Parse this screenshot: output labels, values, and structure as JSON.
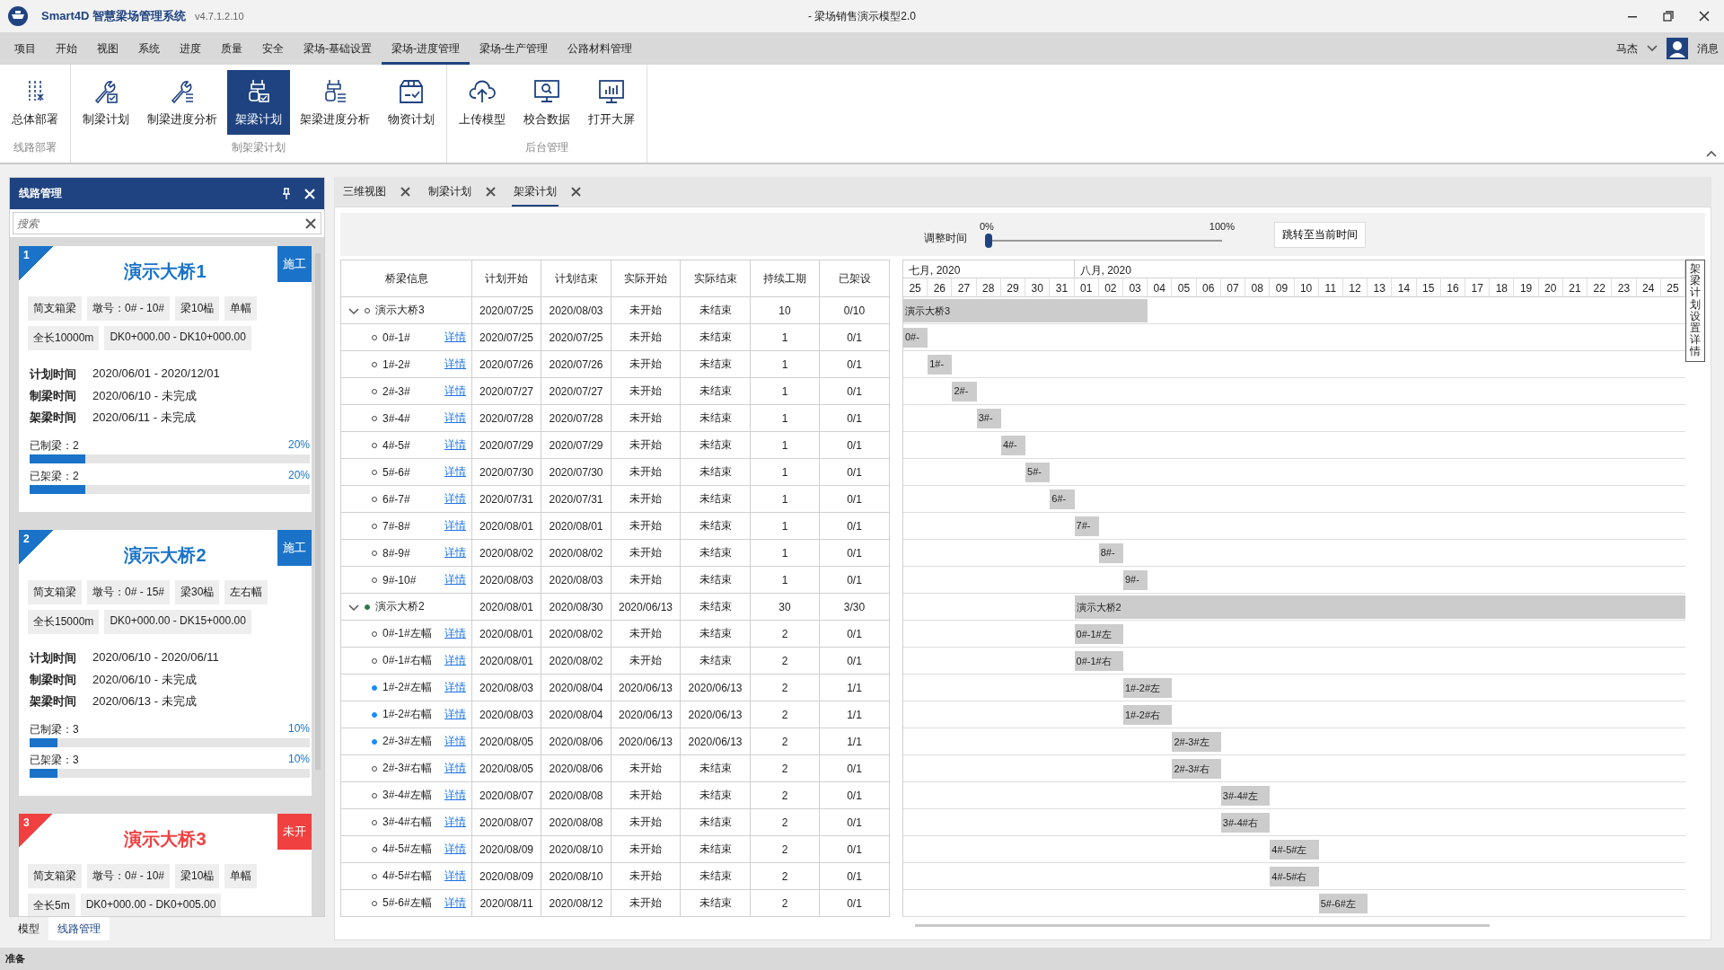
{
  "window": {
    "app_name": "Smart4D 智慧梁场管理系统",
    "version": "v4.7.1.2.10",
    "title": "- 梁场销售演示模型2.0"
  },
  "menu": [
    {
      "label": "项目",
      "selected": false
    },
    {
      "label": "开始",
      "selected": false
    },
    {
      "label": "视图",
      "selected": false
    },
    {
      "label": "系统",
      "selected": false
    },
    {
      "label": "进度",
      "selected": false
    },
    {
      "label": "质量",
      "selected": false
    },
    {
      "label": "安全",
      "selected": false
    },
    {
      "label": "梁场-基础设置",
      "selected": false
    },
    {
      "label": "梁场-进度管理",
      "selected": true
    },
    {
      "label": "梁场-生产管理",
      "selected": false
    },
    {
      "label": "公路材料管理",
      "selected": false
    }
  ],
  "user": {
    "name": "马杰",
    "messages": "消息"
  },
  "ribbon": [
    {
      "label": "线路部署",
      "items": [
        {
          "label": "总体部署",
          "selected": false
        }
      ]
    },
    {
      "label": "制架梁计划",
      "items": [
        {
          "label": "制梁计划",
          "selected": false
        },
        {
          "label": "制梁进度分析",
          "selected": false
        },
        {
          "label": "架梁计划",
          "selected": true
        },
        {
          "label": "架梁进度分析",
          "selected": false
        },
        {
          "label": "物资计划",
          "selected": false
        }
      ]
    },
    {
      "label": "后台管理",
      "items": [
        {
          "label": "上传模型",
          "selected": false
        },
        {
          "label": "校合数据",
          "selected": false
        },
        {
          "label": "打开大屏",
          "selected": false
        }
      ]
    }
  ],
  "side_panel": {
    "title": "线路管理",
    "search": {
      "placeholder": "搜索"
    },
    "bridges": [
      {
        "number": "1",
        "name": "演示大桥1",
        "status": "施工",
        "color": "#1a73c8",
        "tags": [
          "简支箱梁",
          "墩号：0# - 10#",
          "梁10榀",
          "单幅",
          "全长10000m",
          "DK0+000.00 - DK10+000.00"
        ],
        "schedule": [
          {
            "label": "计划时间",
            "value": "2020/06/01 - 2020/12/01"
          },
          {
            "label": "制梁时间",
            "value": "2020/06/10 - 未完成"
          },
          {
            "label": "架梁时间",
            "value": "2020/06/11 - 未完成"
          }
        ],
        "progress": [
          {
            "label": "已制梁：2",
            "percent": "20%",
            "level": 0.2
          },
          {
            "label": "已架梁：2",
            "percent": "20%",
            "level": 0.2
          }
        ]
      },
      {
        "number": "2",
        "name": "演示大桥2",
        "status": "施工",
        "color": "#1a73c8",
        "tags": [
          "简支箱梁",
          "墩号：0# - 15#",
          "梁30榀",
          "左右幅",
          "全长15000m",
          "DK0+000.00 - DK15+000.00"
        ],
        "schedule": [
          {
            "label": "计划时间",
            "value": "2020/06/10 - 2020/06/11"
          },
          {
            "label": "制梁时间",
            "value": "2020/06/10 - 未完成"
          },
          {
            "label": "架梁时间",
            "value": "2020/06/13 - 未完成"
          }
        ],
        "progress": [
          {
            "label": "已制梁：3",
            "percent": "10%",
            "level": 0.1
          },
          {
            "label": "已架梁：3",
            "percent": "10%",
            "level": 0.1
          }
        ]
      },
      {
        "number": "3",
        "name": "演示大桥3",
        "status": "未开",
        "color": "#f04040",
        "tags": [
          "简支箱梁",
          "墩号：0# - 10#",
          "梁10榀",
          "单幅",
          "全长5m",
          "DK0+000.00 - DK0+005.00"
        ]
      }
    ],
    "bottom_tabs": [
      {
        "label": "模型",
        "selected": false
      },
      {
        "label": "线路管理",
        "selected": true
      }
    ]
  },
  "doc_tabs": [
    {
      "label": "三维视图",
      "selected": false
    },
    {
      "label": "制梁计划",
      "selected": false
    },
    {
      "label": "架梁计划",
      "selected": true
    }
  ],
  "timeline": {
    "label": "调整时间",
    "min": "0%",
    "max": "100%",
    "level": 0,
    "button": "跳转至当前时间"
  },
  "table": {
    "columns": [
      "桥梁信息",
      "计划开始",
      "计划结束",
      "实际开始",
      "实际结束",
      "持续工期",
      "已架设"
    ],
    "groups": [
      {
        "name": "演示大桥3",
        "expanded": true,
        "started": false,
        "cells": [
          "2020/07/25",
          "2020/08/03",
          "未开始",
          "未结束",
          "10",
          "0/10"
        ],
        "bar": "演示大桥3",
        "children": [
          {
            "name": "0#-1#",
            "link": "详情",
            "started": false,
            "cells": [
              "2020/07/25",
              "2020/07/25",
              "未开始",
              "未结束",
              "1",
              "0/1"
            ],
            "bar": "0#-"
          },
          {
            "name": "1#-2#",
            "link": "详情",
            "started": false,
            "cells": [
              "2020/07/26",
              "2020/07/26",
              "未开始",
              "未结束",
              "1",
              "0/1"
            ],
            "bar": "1#-"
          },
          {
            "name": "2#-3#",
            "link": "详情",
            "started": false,
            "cells": [
              "2020/07/27",
              "2020/07/27",
              "未开始",
              "未结束",
              "1",
              "0/1"
            ],
            "bar": "2#-"
          },
          {
            "name": "3#-4#",
            "link": "详情",
            "started": false,
            "cells": [
              "2020/07/28",
              "2020/07/28",
              "未开始",
              "未结束",
              "1",
              "0/1"
            ],
            "bar": "3#-"
          },
          {
            "name": "4#-5#",
            "link": "详情",
            "started": false,
            "cells": [
              "2020/07/29",
              "2020/07/29",
              "未开始",
              "未结束",
              "1",
              "0/1"
            ],
            "bar": "4#-"
          },
          {
            "name": "5#-6#",
            "link": "详情",
            "started": false,
            "cells": [
              "2020/07/30",
              "2020/07/30",
              "未开始",
              "未结束",
              "1",
              "0/1"
            ],
            "bar": "5#-"
          },
          {
            "name": "6#-7#",
            "link": "详情",
            "started": false,
            "cells": [
              "2020/07/31",
              "2020/07/31",
              "未开始",
              "未结束",
              "1",
              "0/1"
            ],
            "bar": "6#-"
          },
          {
            "name": "7#-8#",
            "link": "详情",
            "started": false,
            "cells": [
              "2020/08/01",
              "2020/08/01",
              "未开始",
              "未结束",
              "1",
              "0/1"
            ],
            "bar": "7#-"
          },
          {
            "name": "8#-9#",
            "link": "详情",
            "started": false,
            "cells": [
              "2020/08/02",
              "2020/08/02",
              "未开始",
              "未结束",
              "1",
              "0/1"
            ],
            "bar": "8#-"
          },
          {
            "name": "9#-10#",
            "link": "详情",
            "started": false,
            "cells": [
              "2020/08/03",
              "2020/08/03",
              "未开始",
              "未结束",
              "1",
              "0/1"
            ],
            "bar": "9#-"
          }
        ]
      },
      {
        "name": "演示大桥2",
        "expanded": true,
        "started": true,
        "cells": [
          "2020/08/01",
          "2020/08/30",
          "2020/06/13",
          "未结束",
          "30",
          "3/30"
        ],
        "bar": "演示大桥2",
        "children": [
          {
            "name": "0#-1#左幅",
            "link": "详情",
            "started": false,
            "cells": [
              "2020/08/01",
              "2020/08/02",
              "未开始",
              "未结束",
              "2",
              "0/1"
            ],
            "bar": "0#-1#左"
          },
          {
            "name": "0#-1#右幅",
            "link": "详情",
            "started": false,
            "cells": [
              "2020/08/01",
              "2020/08/02",
              "未开始",
              "未结束",
              "2",
              "0/1"
            ],
            "bar": "0#-1#右"
          },
          {
            "name": "1#-2#左幅",
            "link": "详情",
            "started": true,
            "cells": [
              "2020/08/03",
              "2020/08/04",
              "2020/06/13",
              "2020/06/13",
              "2",
              "1/1"
            ],
            "bar": "1#-2#左"
          },
          {
            "name": "1#-2#右幅",
            "link": "详情",
            "started": true,
            "cells": [
              "2020/08/03",
              "2020/08/04",
              "2020/06/13",
              "2020/06/13",
              "2",
              "1/1"
            ],
            "bar": "1#-2#右"
          },
          {
            "name": "2#-3#左幅",
            "link": "详情",
            "started": true,
            "cells": [
              "2020/08/05",
              "2020/08/06",
              "2020/06/13",
              "2020/06/13",
              "2",
              "1/1"
            ],
            "bar": "2#-3#左"
          },
          {
            "name": "2#-3#右幅",
            "link": "详情",
            "started": false,
            "cells": [
              "2020/08/05",
              "2020/08/06",
              "未开始",
              "未结束",
              "2",
              "0/1"
            ],
            "bar": "2#-3#右"
          },
          {
            "name": "3#-4#左幅",
            "link": "详情",
            "started": false,
            "cells": [
              "2020/08/07",
              "2020/08/08",
              "未开始",
              "未结束",
              "2",
              "0/1"
            ],
            "bar": "3#-4#左"
          },
          {
            "name": "3#-4#右幅",
            "link": "详情",
            "started": false,
            "cells": [
              "2020/08/07",
              "2020/08/08",
              "未开始",
              "未结束",
              "2",
              "0/1"
            ],
            "bar": "3#-4#右"
          },
          {
            "name": "4#-5#左幅",
            "link": "详情",
            "started": false,
            "cells": [
              "2020/08/09",
              "2020/08/10",
              "未开始",
              "未结束",
              "2",
              "0/1"
            ],
            "bar": "4#-5#左"
          },
          {
            "name": "4#-5#右幅",
            "link": "详情",
            "started": false,
            "cells": [
              "2020/08/09",
              "2020/08/10",
              "未开始",
              "未结束",
              "2",
              "0/1"
            ],
            "bar": "4#-5#右"
          },
          {
            "name": "5#-6#左幅",
            "link": "详情",
            "started": false,
            "cells": [
              "2020/08/11",
              "2020/08/12",
              "未开始",
              "未结束",
              "2",
              "0/1"
            ],
            "bar": "5#-6#左"
          }
        ]
      }
    ]
  },
  "gantt": {
    "months": [
      {
        "label": "七月, 2020",
        "days": [
          "25",
          "26",
          "27",
          "28",
          "29",
          "30",
          "31"
        ]
      },
      {
        "label": "八月, 2020",
        "days": [
          "01",
          "02",
          "03",
          "04",
          "05",
          "06",
          "07",
          "08",
          "09",
          "10",
          "11",
          "12",
          "13",
          "14",
          "15",
          "16",
          "17",
          "18",
          "19",
          "20",
          "21",
          "22",
          "23",
          "24",
          "25"
        ]
      }
    ],
    "side_tab": "架梁计划设置详情"
  },
  "status_bar": "准备"
}
